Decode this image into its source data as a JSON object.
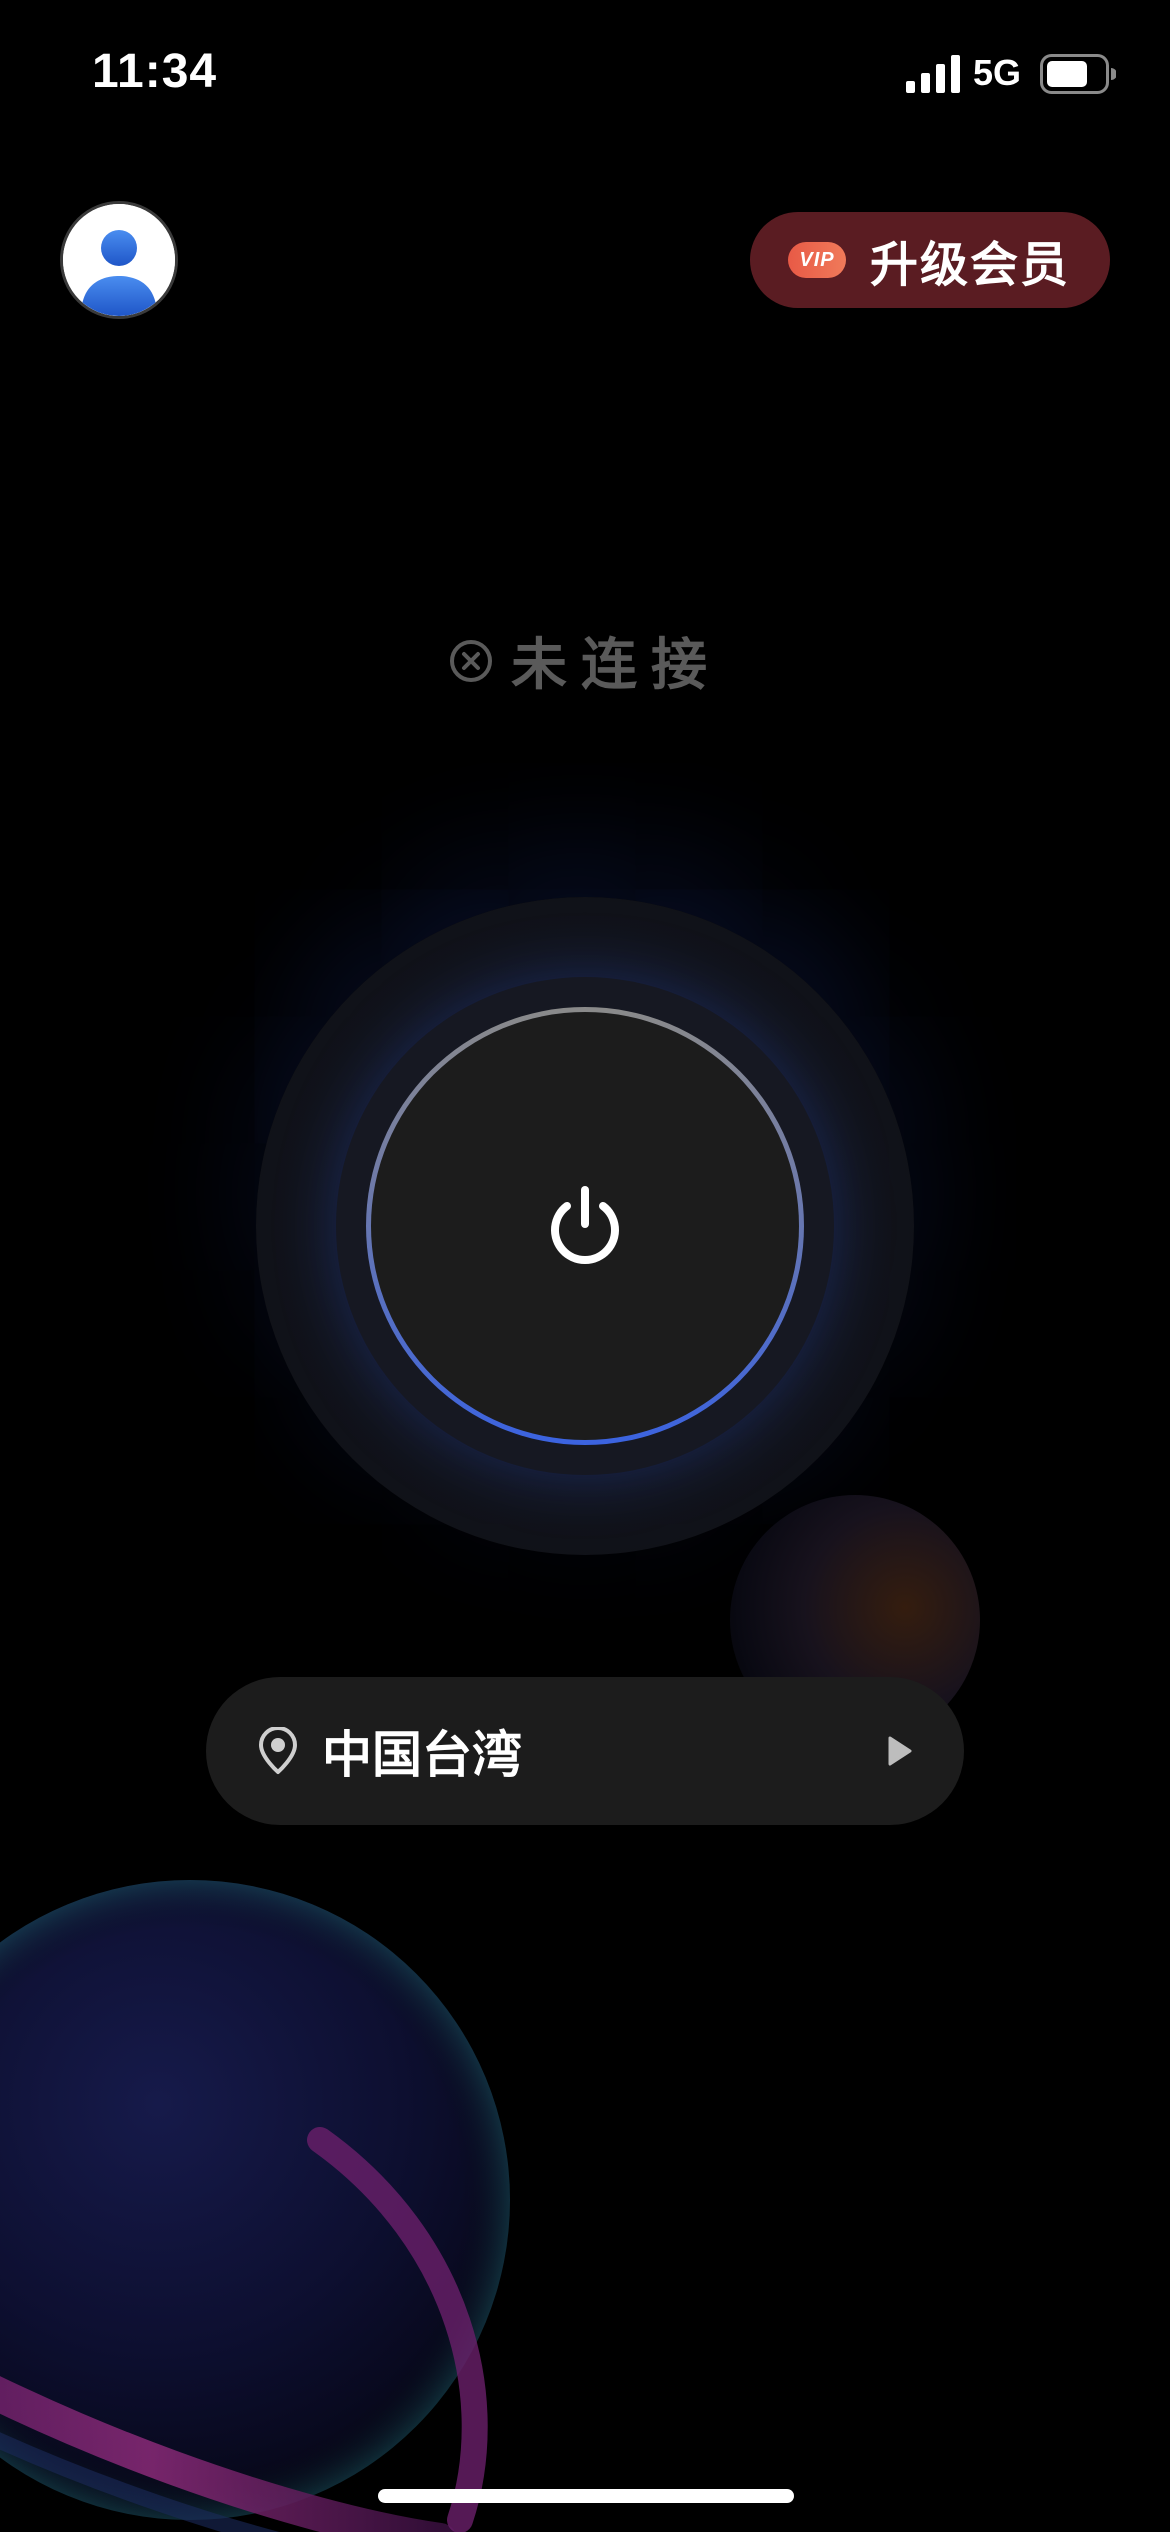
{
  "status_bar": {
    "time": "11:34",
    "network": "5G",
    "signal_icon": "cellular-signal-icon",
    "battery_icon": "battery-icon"
  },
  "header": {
    "avatar_icon": "user-avatar-icon",
    "vip_button": {
      "badge": "VIP",
      "label": "升级会员",
      "background": "#5a1c22",
      "badge_color": "#e85a46"
    }
  },
  "connection": {
    "status_icon": "x-circle-icon",
    "status_label": "未连接",
    "power_icon": "power-icon",
    "ring_accent": "#3b63e0"
  },
  "location": {
    "pin_icon": "location-pin-icon",
    "label": "中国台湾",
    "chevron_icon": "play-triangle-icon"
  },
  "colors": {
    "background": "#000000",
    "surface": "#1c1c1c",
    "muted_text": "#5a5a5a"
  }
}
